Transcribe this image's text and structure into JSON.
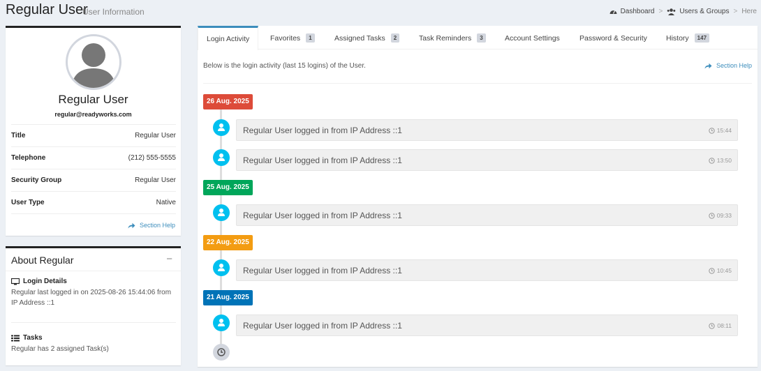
{
  "header": {
    "title": "Regular User",
    "subtitle": "User Information",
    "breadcrumbs": [
      {
        "label": "Dashboard",
        "icon": "dashboard-icon"
      },
      {
        "label": "Users & Groups",
        "icon": "users-icon"
      },
      {
        "label": "Here"
      }
    ]
  },
  "profile": {
    "name": "Regular User",
    "email": "regular@readyworks.com",
    "fields": [
      {
        "label": "Title",
        "value": "Regular User"
      },
      {
        "label": "Telephone",
        "value": "(212) 555-5555"
      },
      {
        "label": "Security Group",
        "value": "Regular User"
      },
      {
        "label": "User Type",
        "value": "Native"
      }
    ],
    "help_label": "Section Help"
  },
  "about": {
    "title": "About Regular",
    "collapse_symbol": "−",
    "login_details_title": "Login Details",
    "login_details_text": "Regular last logged in on 2025-08-26 15:44:06 from IP Address ::1",
    "tasks_title": "Tasks",
    "tasks_text": "Regular has 2 assigned Task(s)"
  },
  "tabs": [
    {
      "label": "Login Activity",
      "badge": null,
      "active": true
    },
    {
      "label": "Favorites",
      "badge": "1",
      "active": false
    },
    {
      "label": "Assigned Tasks",
      "badge": "2",
      "active": false
    },
    {
      "label": "Task Reminders",
      "badge": "3",
      "active": false
    },
    {
      "label": "Account Settings",
      "badge": null,
      "active": false
    },
    {
      "label": "Password & Security",
      "badge": null,
      "active": false
    },
    {
      "label": "History",
      "badge": "147",
      "active": false
    }
  ],
  "activity": {
    "intro": "Below is the login activity (last 15 logins) of the User.",
    "help_label": "Section Help",
    "groups": [
      {
        "date": "26 Aug. 2025",
        "color": "#dd4b39",
        "entries": [
          {
            "message": "Regular User logged in from IP Address ::1",
            "time": "15:44"
          },
          {
            "message": "Regular User logged in from IP Address ::1",
            "time": "13:50"
          }
        ]
      },
      {
        "date": "25 Aug. 2025",
        "color": "#00a65a",
        "entries": [
          {
            "message": "Regular User logged in from IP Address ::1",
            "time": "09:33"
          }
        ]
      },
      {
        "date": "22 Aug. 2025",
        "color": "#f39c12",
        "entries": [
          {
            "message": "Regular User logged in from IP Address ::1",
            "time": "10:45"
          }
        ]
      },
      {
        "date": "21 Aug. 2025",
        "color": "#0073b7",
        "entries": [
          {
            "message": "Regular User logged in from IP Address ::1",
            "time": "08:11"
          }
        ]
      }
    ]
  }
}
